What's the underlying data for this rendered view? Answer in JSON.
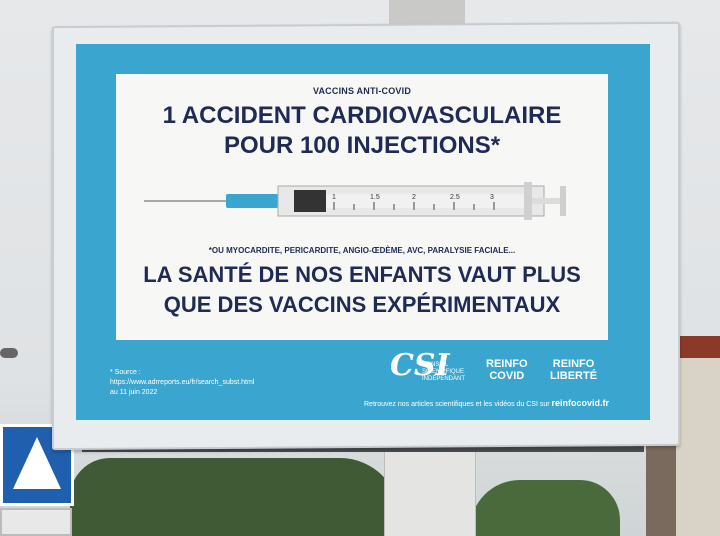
{
  "poster": {
    "kicker": "VACCINS ANTI-COVID",
    "headline_line1": "1 ACCIDENT CARDIOVASCULAIRE",
    "headline_line2": "POUR 100 INJECTIONS*",
    "footnote": "*OU MYOCARDITE, PERICARDITE, ANGIO-ŒDÈME, AVC, PARALYSIE FACIALE...",
    "bottom_line1": "LA SANTÉ DE NOS ENFANTS VAUT PLUS",
    "bottom_line2": "QUE DES VACCINS EXPÉRIMENTAUX",
    "syringe_marks": [
      "1",
      "1.5",
      "2",
      "2.5",
      "3"
    ],
    "source_label": "* Source :",
    "source_url": "https://www.adrreports.eu/fr/search_subst.html",
    "source_date": "au 11 juin 2022",
    "csi_logo": "CSI",
    "csi_line1": "CONSEIL",
    "csi_line2": "SCIENTIFIQUE",
    "csi_line3": "INDÉPENDANT",
    "logo1_line1": "REINFO",
    "logo1_line2": "COVID",
    "logo2_line1": "REINFO",
    "logo2_line2": "LIBERTÉ",
    "site_text": "Retrouvez nos articles scientifiques et les vidéos du CSI sur",
    "site_domain": "reinfocovid.fr"
  },
  "colors": {
    "poster_blue": "#3aa6cf",
    "text_navy": "#1f2a55",
    "needle_teal": "#3aa6cf"
  }
}
